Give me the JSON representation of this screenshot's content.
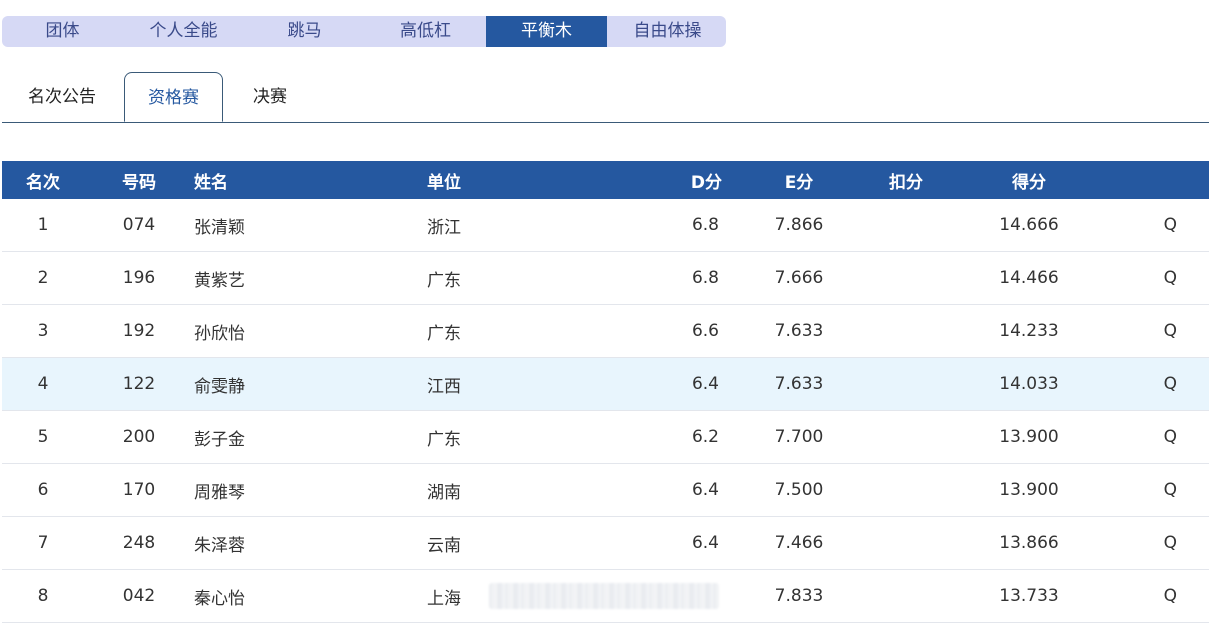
{
  "event_tabs": [
    "团体",
    "个人全能",
    "跳马",
    "高低杠",
    "平衡木",
    "自由体操"
  ],
  "event_tab_active": "平衡木",
  "phase_tabs": [
    "名次公告",
    "资格赛",
    "决赛"
  ],
  "phase_tab_active": "资格赛",
  "table": {
    "headers": {
      "rank": "名次",
      "number": "号码",
      "name": "姓名",
      "unit": "单位",
      "d": "D分",
      "e": "E分",
      "deduction": "扣分",
      "total": "得分"
    },
    "rows": [
      {
        "rank": "1",
        "number": "074",
        "name": "张清颖",
        "unit": "浙江",
        "d": "6.8",
        "e": "7.866",
        "deduction": "",
        "total": "14.666",
        "q": "Q"
      },
      {
        "rank": "2",
        "number": "196",
        "name": "黄紫艺",
        "unit": "广东",
        "d": "6.8",
        "e": "7.666",
        "deduction": "",
        "total": "14.466",
        "q": "Q"
      },
      {
        "rank": "3",
        "number": "192",
        "name": "孙欣怡",
        "unit": "广东",
        "d": "6.6",
        "e": "7.633",
        "deduction": "",
        "total": "14.233",
        "q": "Q"
      },
      {
        "rank": "4",
        "number": "122",
        "name": "俞雯静",
        "unit": "江西",
        "d": "6.4",
        "e": "7.633",
        "deduction": "",
        "total": "14.033",
        "q": "Q"
      },
      {
        "rank": "5",
        "number": "200",
        "name": "彭子金",
        "unit": "广东",
        "d": "6.2",
        "e": "7.700",
        "deduction": "",
        "total": "13.900",
        "q": "Q"
      },
      {
        "rank": "6",
        "number": "170",
        "name": "周雅琴",
        "unit": "湖南",
        "d": "6.4",
        "e": "7.500",
        "deduction": "",
        "total": "13.900",
        "q": "Q"
      },
      {
        "rank": "7",
        "number": "248",
        "name": "朱泽蓉",
        "unit": "云南",
        "d": "6.4",
        "e": "7.466",
        "deduction": "",
        "total": "13.866",
        "q": "Q"
      },
      {
        "rank": "8",
        "number": "042",
        "name": "秦心怡",
        "unit": "上海",
        "d": "",
        "e": "7.833",
        "deduction": "",
        "total": "13.733",
        "q": "Q",
        "d_obscured": true
      }
    ],
    "highlight_rank": "4"
  }
}
